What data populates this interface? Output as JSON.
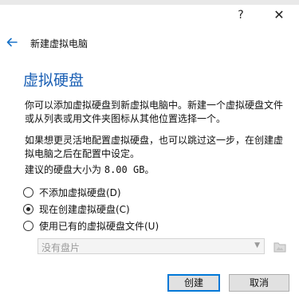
{
  "titlebar": {
    "help_glyph": "?",
    "close_glyph": "✕"
  },
  "wizard": {
    "title": "新建虚拟电脑",
    "heading": "虚拟硬盘",
    "paragraph1": "你可以添加虚拟硬盘到新虚拟电脑中。新建一个虚拟硬盘文件或从列表或用文件夹图标从其他位置选择一个。",
    "paragraph2": "如果想更灵活地配置虚拟硬盘，也可以跳过这一步，在创建虚拟电脑之后在配置中设定。",
    "size_label": "建议的硬盘大小为",
    "size_value": "8.00 GB",
    "size_suffix": "。"
  },
  "options": [
    {
      "label": "不添加虚拟硬盘(D)",
      "checked": false
    },
    {
      "label": "现在创建虚拟硬盘(C)",
      "checked": true
    },
    {
      "label": "使用已有的虚拟硬盘文件(U)",
      "checked": false
    }
  ],
  "disk_select": {
    "selected": "没有盘片"
  },
  "buttons": {
    "create": "创建",
    "cancel": "取消"
  },
  "colors": {
    "heading": "#1a5fb4",
    "accent": "#0078d7"
  }
}
